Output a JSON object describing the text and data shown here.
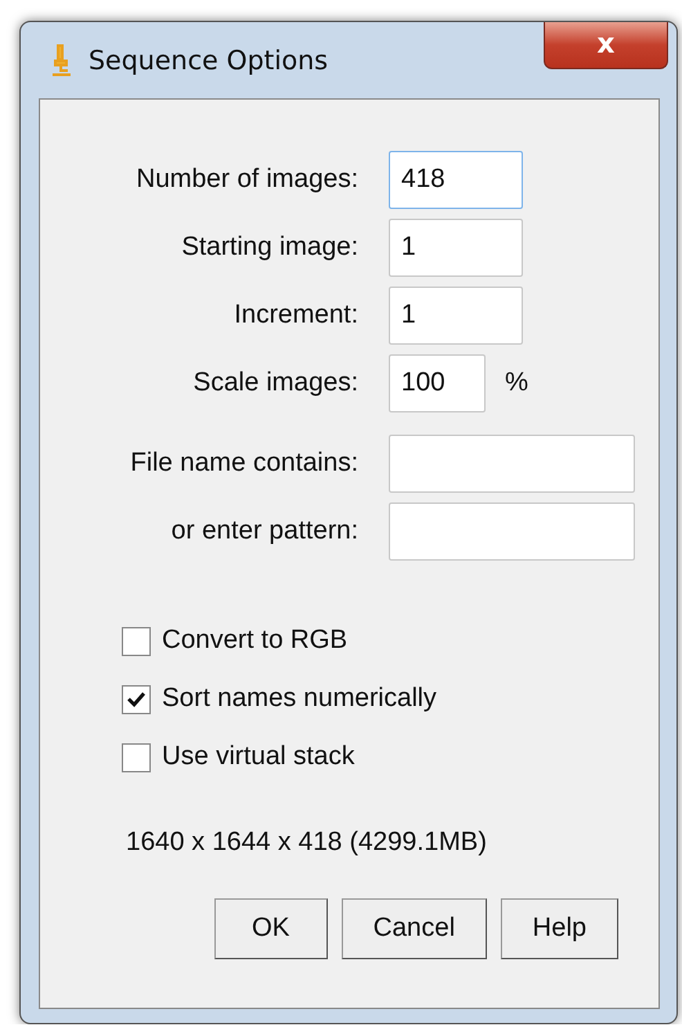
{
  "window": {
    "title": "Sequence Options",
    "close_label": "x"
  },
  "fields": [
    {
      "kind": "count",
      "label": "Number of images:",
      "value": "418",
      "focused": true
    },
    {
      "kind": "count",
      "label": "Starting image:",
      "value": "1",
      "focused": false
    },
    {
      "kind": "count",
      "label": "Increment:",
      "value": "1",
      "focused": false
    },
    {
      "kind": "percent",
      "label": "Scale images:",
      "value": "100",
      "unit": "%",
      "focused": false
    },
    {
      "kind": "pattern",
      "label": "File name contains:",
      "focused": false
    },
    {
      "kind": "pattern",
      "label": "or enter pattern:",
      "focused": false
    }
  ],
  "checkboxes": [
    {
      "label": "Convert to RGB",
      "checked": false
    },
    {
      "label": "Sort names numerically",
      "checked": true
    },
    {
      "label": "Use virtual stack",
      "checked": false
    }
  ],
  "info": "1640 x 1644 x 418 (4299.1MB)",
  "buttons": [
    "OK",
    "Cancel",
    "Help"
  ]
}
